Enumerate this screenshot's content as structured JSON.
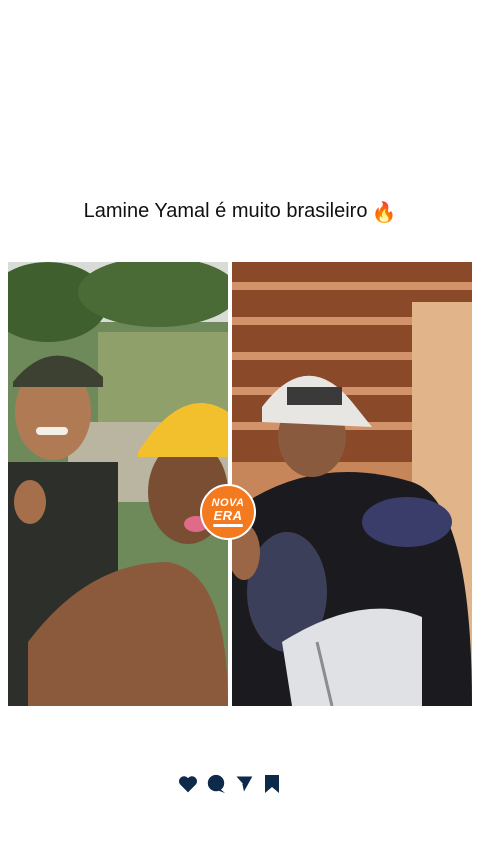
{
  "post": {
    "caption": "Lamine Yamal é muito brasileiro",
    "caption_emoji": "🔥"
  },
  "badge": {
    "line1": "NOVA",
    "line2": "ERA"
  },
  "colors": {
    "badge": "#f47a20",
    "icons": "#0d2a4a"
  },
  "actions": [
    {
      "icon": "heart-icon"
    },
    {
      "icon": "comment-icon"
    },
    {
      "icon": "share-icon"
    },
    {
      "icon": "bookmark-icon"
    }
  ]
}
